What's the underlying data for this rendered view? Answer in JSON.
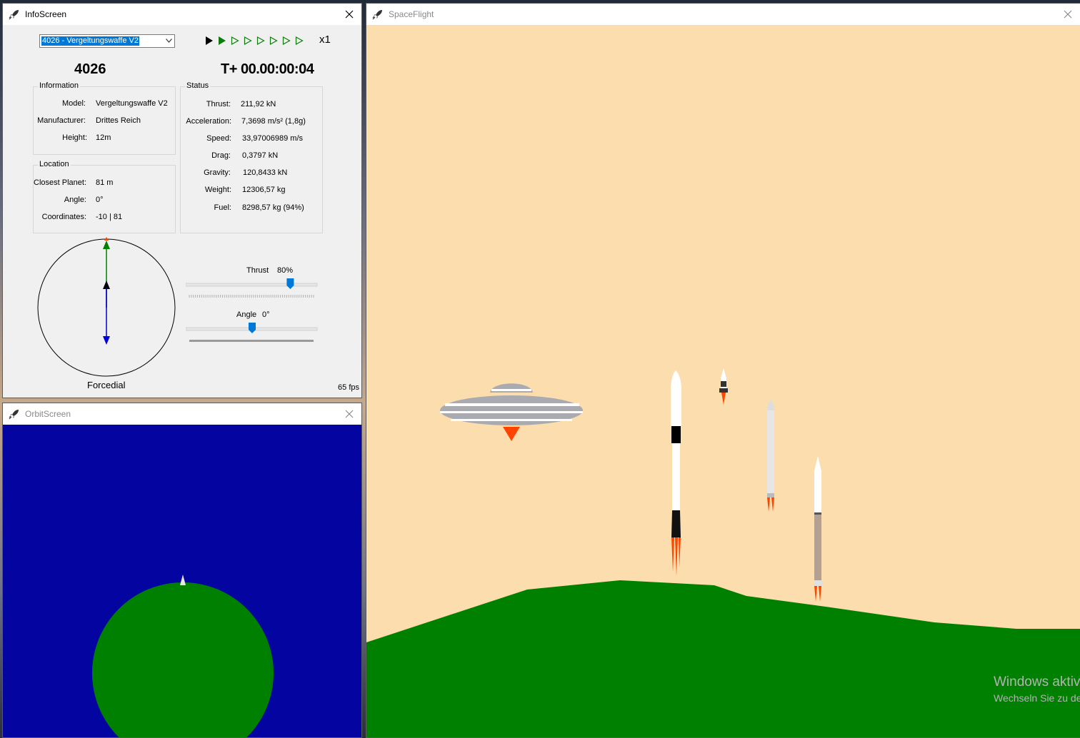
{
  "info_window": {
    "title": "InfoScreen",
    "rocket_select_value": "4026 - Vergeltungswaffe V2",
    "speed_multiplier": "x1",
    "rocket_id": "4026",
    "mission_time": "T+ 00.00:00:04",
    "fps": "65 fps",
    "information": {
      "legend": "Information",
      "model_label": "Model:",
      "model": "Vergeltungswaffe V2",
      "manufacturer_label": "Manufacturer:",
      "manufacturer": "Drittes Reich",
      "height_label": "Height:",
      "height": "12m"
    },
    "location": {
      "legend": "Location",
      "closest_planet_label": "Closest Planet:",
      "closest_planet": "81 m",
      "angle_label": "Angle:",
      "angle": "0°",
      "coordinates_label": "Coordinates:",
      "coordinates": "-10 | 81"
    },
    "status": {
      "legend": "Status",
      "thrust_label": "Thrust:",
      "thrust": "211,92 kN",
      "acceleration_label": "Acceleration:",
      "acceleration": "7,3698 m/s² (1,8g)",
      "speed_label": "Speed:",
      "speed": "33,97006989 m/s",
      "drag_label": "Drag:",
      "drag": "0,3797 kN",
      "gravity_label": "Gravity:",
      "gravity": "120,8433 kN",
      "weight_label": "Weight:",
      "weight": "12306,57 kg",
      "fuel_label": "Fuel:",
      "fuel": "8298,57 kg (94%)"
    },
    "forcedial_label": "Forcedial",
    "thrust_slider": {
      "label": "Thrust",
      "value_text": "80%",
      "value": 0.8
    },
    "angle_slider": {
      "label": "Angle",
      "value_text": "0°",
      "value": 0.5
    }
  },
  "orbit_window": {
    "title": "OrbitScreen"
  },
  "space_window": {
    "title": "SpaceFlight"
  },
  "watermark": {
    "line1": "Windows aktiv",
    "line2": "Wechseln Sie zu de"
  },
  "colors": {
    "sky": "#fcdeae",
    "ground": "#008000",
    "orbit_bg": "#0404a0",
    "planet": "#008000",
    "flame": "#ff4500",
    "slider_thumb": "#0078d7",
    "selection": "#0078d7"
  }
}
